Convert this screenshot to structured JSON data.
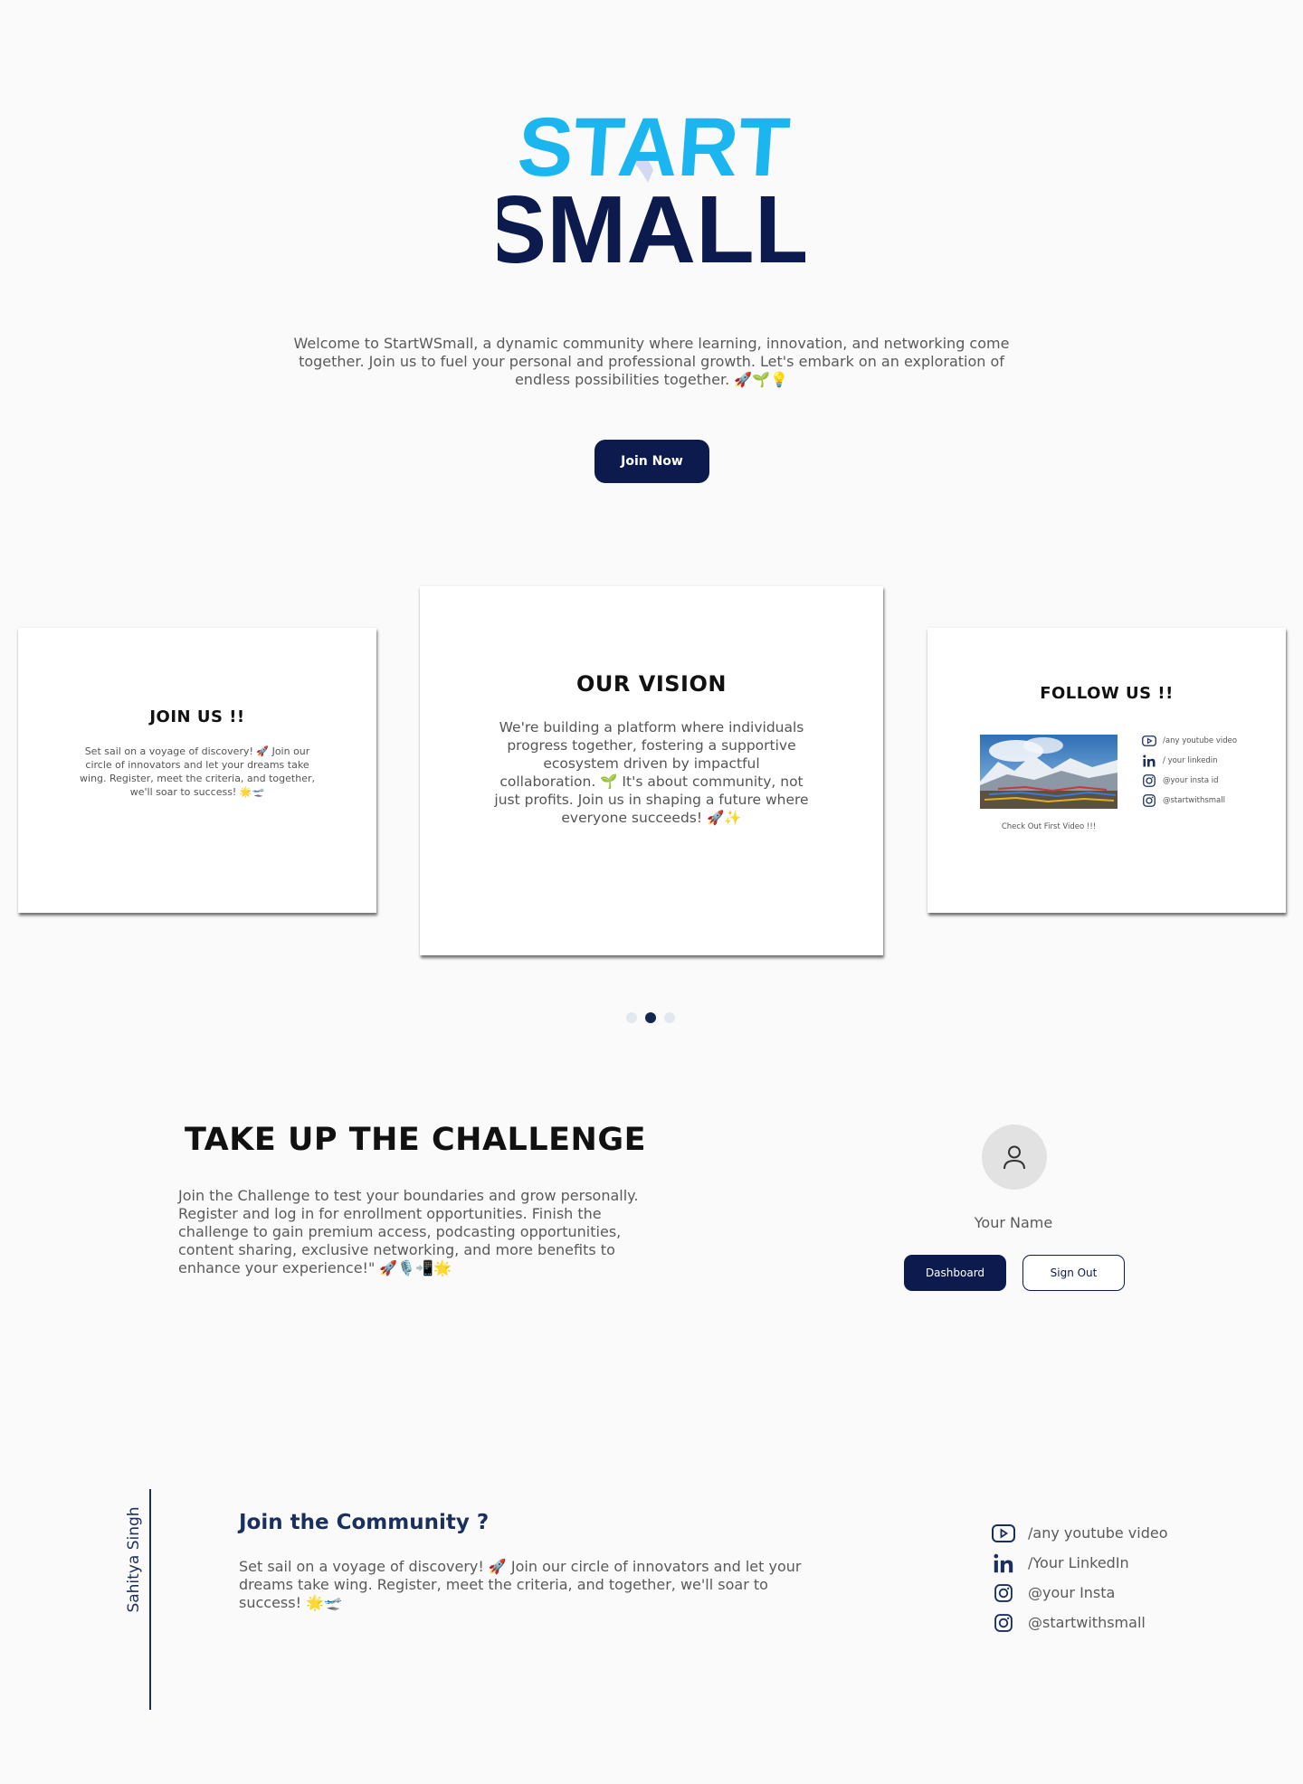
{
  "logo": {
    "line1": "START",
    "line2": "SMALL",
    "colors": {
      "start": "#1bb6f0",
      "small": "#0c1a4e"
    }
  },
  "hero": {
    "welcome": "Welcome to StartWSmall, a dynamic community where learning, innovation, and networking come together. Join us to fuel your personal and professional growth. Let's embark on an exploration of endless possibilities together. 🚀🌱💡",
    "join_button": "Join Now"
  },
  "carousel": {
    "cards": [
      {
        "title": "JOIN US !!",
        "text": "Set sail on a voyage of discovery! 🚀 Join our circle of innovators and let your dreams take wing. Register, meet the criteria, and together, we'll soar to success! 🌟🛫"
      },
      {
        "title": "OUR VISION",
        "text": "We're building a platform where individuals progress together, fostering a supportive ecosystem driven by impactful collaboration. 🌱 It's about community, not just profits. Join us in shaping a future where everyone succeeds! 🚀✨"
      },
      {
        "title": "FOLLOW US !!",
        "video_caption": "Check Out First Video !!!",
        "links": [
          {
            "icon": "youtube-icon",
            "label": "/any youtube video"
          },
          {
            "icon": "linkedin-icon",
            "label": "/ your linkedin"
          },
          {
            "icon": "instagram-icon",
            "label": "@your insta id"
          },
          {
            "icon": "instagram-icon",
            "label": "@startwithsmall"
          }
        ]
      }
    ],
    "active_index": 1
  },
  "challenge": {
    "title": "TAKE UP THE CHALLENGE",
    "text": "Join the Challenge to test your boundaries and grow personally. Register and log in for enrollment opportunities. Finish the challenge to gain premium access, podcasting opportunities, content sharing, exclusive networking, and more benefits to enhance your experience!\" 🚀🎙️📲🌟"
  },
  "profile": {
    "name": "Your Name",
    "dashboard_button": "Dashboard",
    "signout_button": "Sign Out"
  },
  "footer": {
    "author": "Sahitya Singh",
    "title": "Join the Community ?",
    "text": "Set sail on a voyage of discovery! 🚀 Join our circle of innovators and let your dreams take wing. Register, meet the criteria, and together, we'll soar to success! 🌟🛫",
    "links": [
      {
        "icon": "youtube-icon",
        "label": "/any youtube video"
      },
      {
        "icon": "linkedin-icon",
        "label": "/Your LinkedIn"
      },
      {
        "icon": "instagram-icon",
        "label": "@your Insta"
      },
      {
        "icon": "instagram-icon",
        "label": "@startwithsmall"
      }
    ]
  }
}
